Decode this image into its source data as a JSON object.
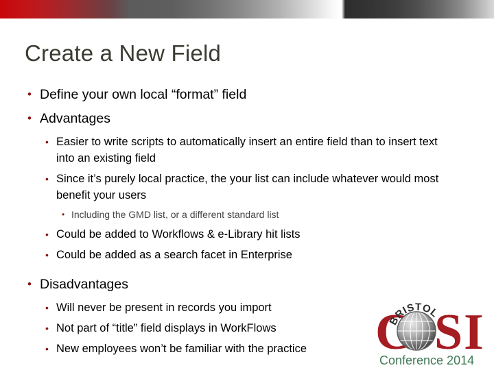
{
  "slide": {
    "title": "Create a New Field",
    "bullets": [
      {
        "level": 1,
        "text": "Define your own local “format” field"
      },
      {
        "level": 1,
        "text": "Advantages"
      },
      {
        "level": 2,
        "text": "Easier to write scripts to automatically insert an entire field than to insert text into an existing field"
      },
      {
        "level": 2,
        "text": "Since it’s purely local practice, the your list can include whatever would most benefit your users"
      },
      {
        "level": 3,
        "text": "Including the GMD list, or a different standard list"
      },
      {
        "level": 2,
        "text": "Could be added to Workflows & e-Library hit lists"
      },
      {
        "level": 2,
        "text": "Could be added as a search facet in Enterprise"
      },
      {
        "level": 1,
        "text": "Disadvantages"
      },
      {
        "level": 2,
        "text": "Will never be present in records you import"
      },
      {
        "level": 2,
        "text": "Not part of “title” field displays in WorkFlows"
      },
      {
        "level": 2,
        "text": "New employees won’t be familiar with the practice"
      }
    ],
    "bullet_glyph": "•"
  },
  "logo": {
    "brand": "COSI",
    "letters": {
      "c": "C",
      "s": "S",
      "i": "I"
    },
    "arc_text": "BRISTOL",
    "tagline": "Conference 2014",
    "colors": {
      "brand_red": "#a51c22",
      "tagline_green": "#3f7a55",
      "globe_dark": "#4b4b4b",
      "globe_light": "#d4d4d4",
      "arc_text": "#2b2b2b"
    }
  },
  "theme": {
    "title_color": "#3b3b33",
    "bullet_color": "#8c1616",
    "body_text_color": "#000000",
    "sub_text_color": "#454545",
    "banner_red": "#c8070a",
    "background": "#ffffff"
  }
}
